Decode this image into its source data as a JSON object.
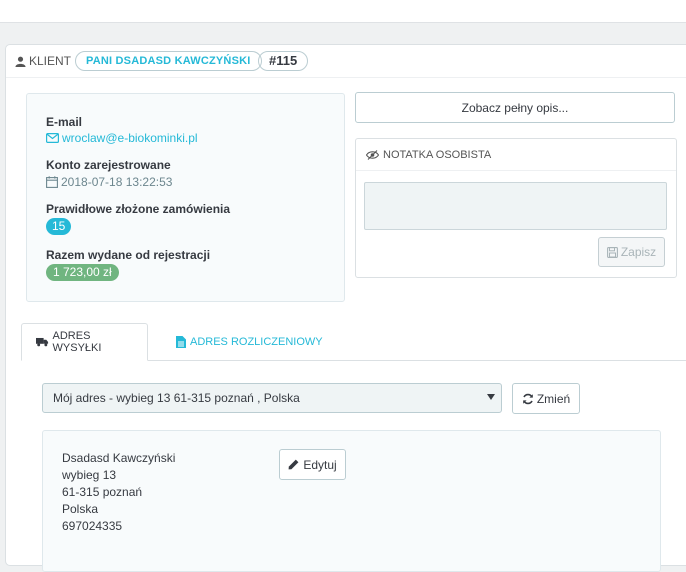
{
  "header": {
    "client_label": "KLIENT",
    "customer_name": "PANI DSADASD KAWCZYŃSKI",
    "customer_id": "#115"
  },
  "info": {
    "email_label": "E-mail",
    "email_value": "wroclaw@e-biokominki.pl",
    "registered_label": "Konto zarejestrowane",
    "registered_value": "2018-07-18 13:22:53",
    "orders_label": "Prawidłowe złożone zamówienia",
    "orders_value": "15",
    "spent_label": "Razem wydane od rejestracji",
    "spent_value": "1 723,00 zł"
  },
  "buttons": {
    "full_description": "Zobacz pełny opis...",
    "save": "Zapisz",
    "change": "Zmień",
    "edit": "Edytuj"
  },
  "note": {
    "title": "NOTATKA OSOBISTA",
    "value": ""
  },
  "tabs": {
    "shipping": "ADRES WYSYŁKI",
    "billing": "ADRES ROZLICZENIOWY"
  },
  "address_select": {
    "selected": "Mój adres - wybieg 13 61-315 poznań , Polska"
  },
  "address": {
    "name": "Dsadasd Kawczyński",
    "street": "wybieg 13",
    "city": "61-315 poznań",
    "country": "Polska",
    "phone": "697024335"
  },
  "colors": {
    "accent": "#25b9d7",
    "success": "#70b580",
    "text": "#363a41"
  }
}
